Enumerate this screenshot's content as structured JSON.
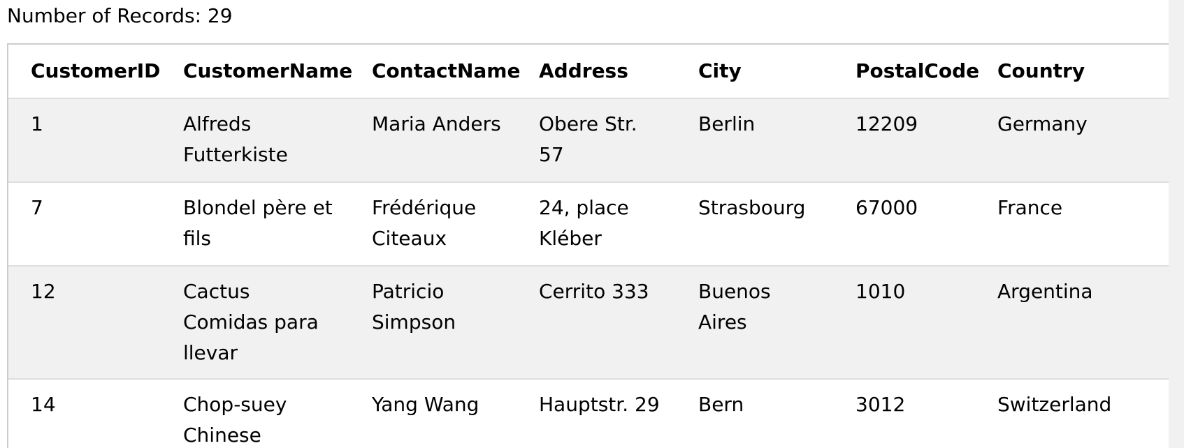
{
  "records_label": "Number of Records: 29",
  "columns": [
    "CustomerID",
    "CustomerName",
    "ContactName",
    "Address",
    "City",
    "PostalCode",
    "Country"
  ],
  "rows": [
    [
      "1",
      "Alfreds Futterkiste",
      "Maria Anders",
      "Obere Str. 57",
      "Berlin",
      "12209",
      "Germany"
    ],
    [
      "7",
      "Blondel père et fils",
      "Frédérique Citeaux",
      "24, place Kléber",
      "Strasbourg",
      "67000",
      "France"
    ],
    [
      "12",
      "Cactus Comidas para llevar",
      "Patricio Simpson",
      "Cerrito 333",
      "Buenos Aires",
      "1010",
      "Argentina"
    ],
    [
      "14",
      "Chop-suey Chinese",
      "Yang Wang",
      "Hauptstr. 29",
      "Bern",
      "3012",
      "Switzerland"
    ]
  ]
}
